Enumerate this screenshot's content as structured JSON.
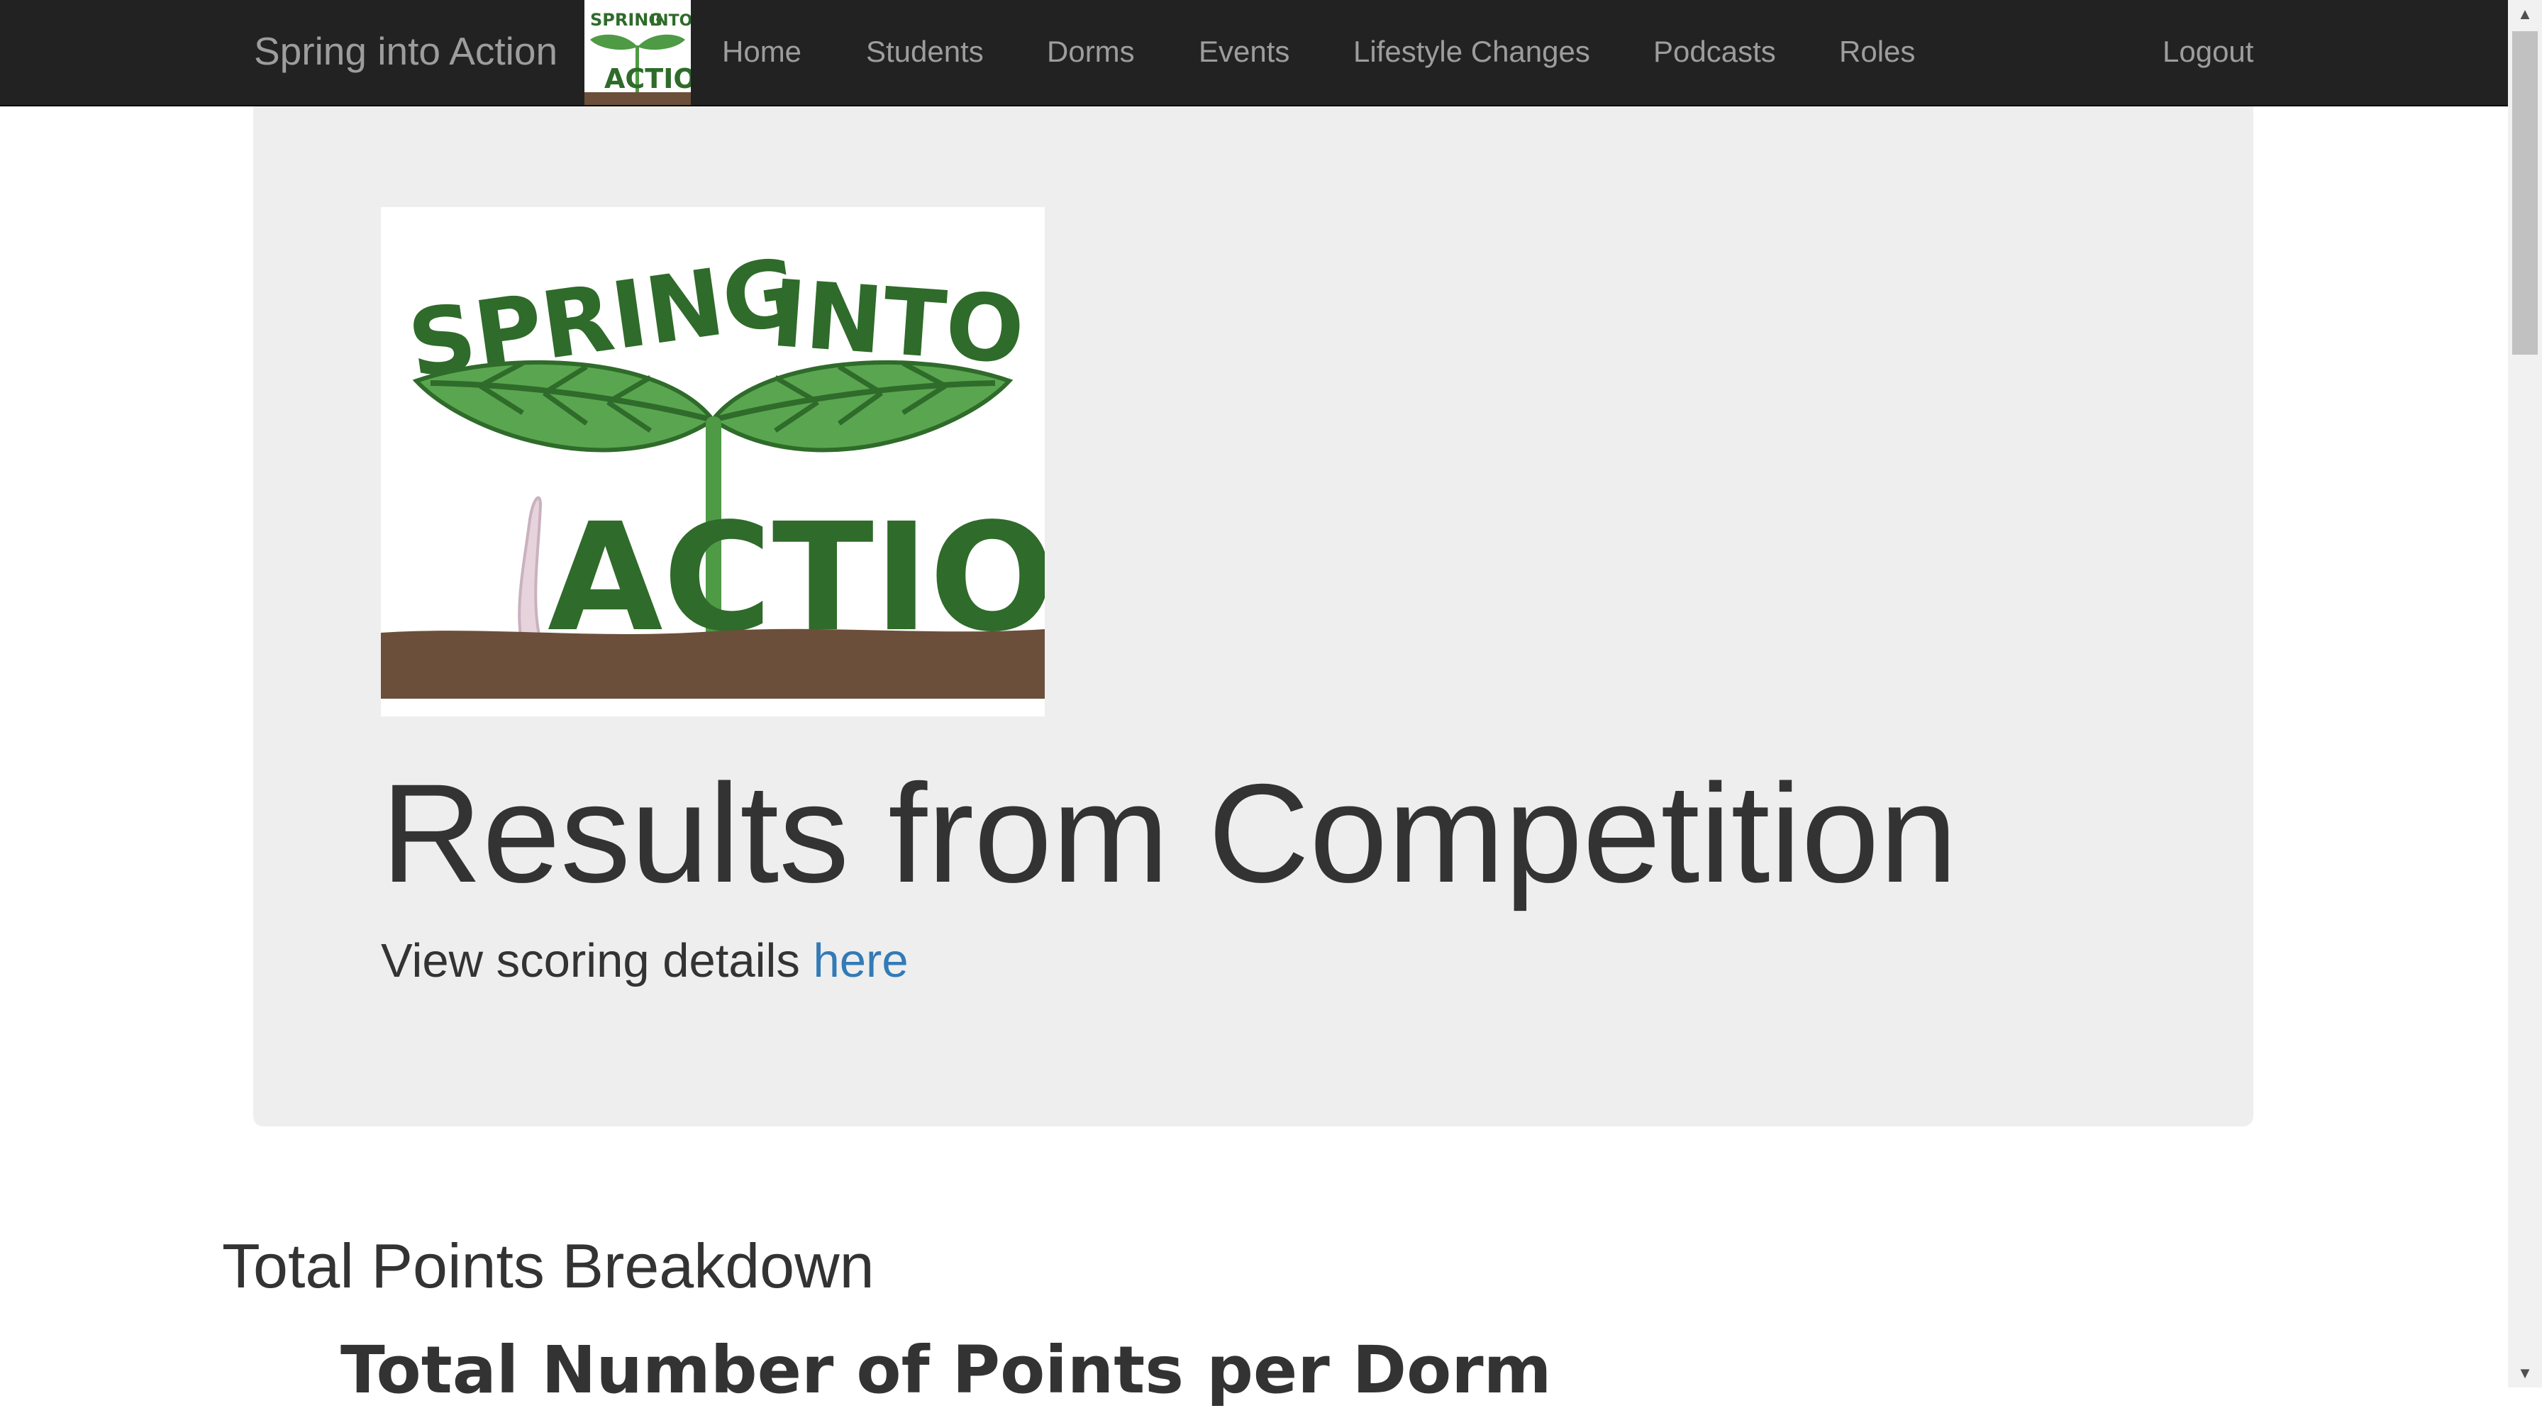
{
  "navbar": {
    "brand": "Spring into Action",
    "logo_alt": "Spring into Action logo",
    "items": [
      {
        "label": "Home"
      },
      {
        "label": "Students"
      },
      {
        "label": "Dorms"
      },
      {
        "label": "Events"
      },
      {
        "label": "Lifestyle Changes"
      },
      {
        "label": "Podcasts"
      },
      {
        "label": "Roles"
      }
    ],
    "logout": "Logout",
    "background_color": "#222222",
    "link_color": "#9d9d9d"
  },
  "logo": {
    "top_words": [
      "SPRING",
      "INTO"
    ],
    "bottom_word": "ACTION",
    "leaf_color": "#4e9a45",
    "text_color": "#2f6b2a",
    "soil_color": "#6b4f3a",
    "worm_color": "#e7d3dc"
  },
  "hero": {
    "title": "Results from Competition",
    "subtitle_prefix": "View scoring details",
    "subtitle_link": "here",
    "background_color": "#eeeeee",
    "link_color": "#337ab7"
  },
  "section": {
    "title": "Total Points Breakdown"
  },
  "chart": {
    "title": "Total Number of Points per Dorm"
  }
}
